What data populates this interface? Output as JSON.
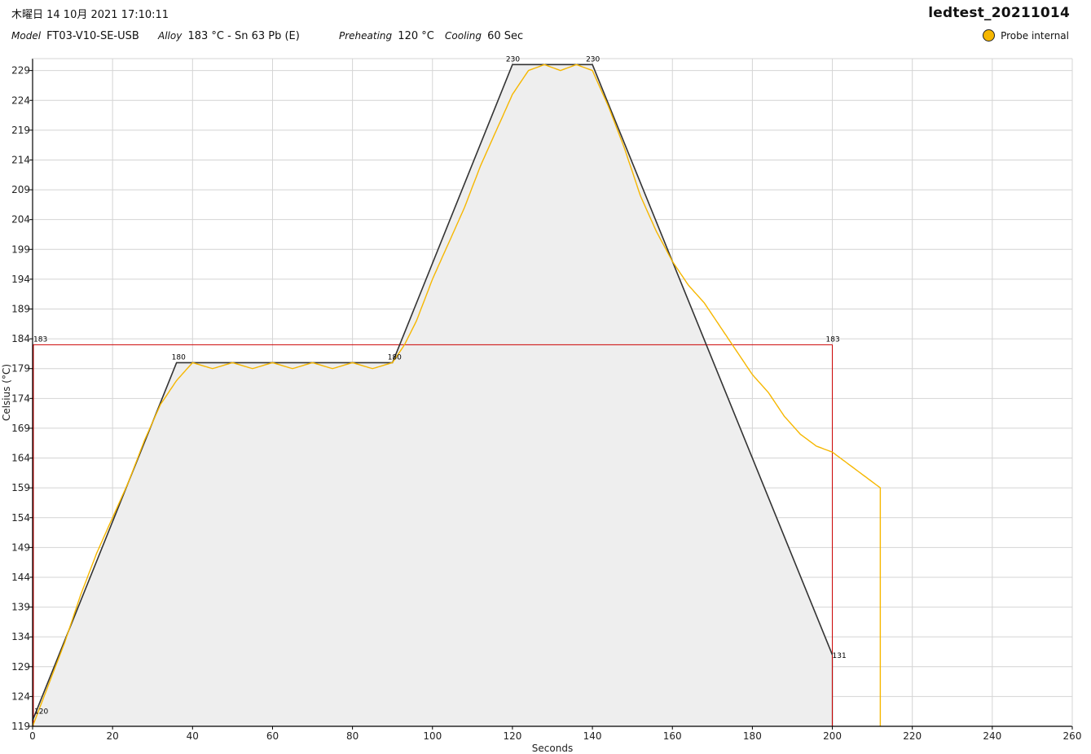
{
  "header": {
    "datetime": "木曜日 14 10月 2021 17:10:11",
    "title": "ledtest_20211014",
    "model_label": "Model",
    "model_value": "FT03-V10-SE-USB",
    "alloy_label": "Alloy",
    "alloy_value": "183 °C - Sn 63 Pb (E)",
    "preheating_label": "Preheating",
    "preheating_value": "120 °C",
    "cooling_label": "Cooling",
    "cooling_value": "60 Sec"
  },
  "legend": {
    "probe_label": "Probe internal",
    "probe_color": "#f6b700"
  },
  "colors": {
    "profile": "#333333",
    "fill": "#eeeeee",
    "alloy_line": "#cc0000",
    "grid": "#d4d4d4"
  },
  "chart_data": {
    "type": "line",
    "xlabel": "Seconds",
    "ylabel": "Celsius (°C)",
    "xlim": [
      0,
      260
    ],
    "ylim": [
      119,
      231
    ],
    "x_ticks": [
      0,
      20,
      40,
      60,
      80,
      100,
      120,
      140,
      160,
      180,
      200,
      220,
      240,
      260
    ],
    "y_ticks": [
      119,
      124,
      129,
      134,
      139,
      144,
      149,
      154,
      159,
      164,
      169,
      174,
      179,
      184,
      189,
      194,
      199,
      204,
      209,
      214,
      219,
      224,
      229
    ],
    "grid": true,
    "legend_position": "top-right",
    "profile": {
      "x": [
        0,
        36,
        90,
        120,
        140,
        200
      ],
      "y": [
        120,
        180,
        180,
        230,
        230,
        131
      ],
      "point_labels": [
        "120",
        "180",
        "180",
        "230",
        "230",
        "131"
      ]
    },
    "alloy_threshold": {
      "y": 183,
      "x_end": 200,
      "labels": [
        "183",
        "183"
      ]
    },
    "series": [
      {
        "name": "Probe internal",
        "x": [
          0,
          4,
          8,
          12,
          16,
          20,
          24,
          28,
          32,
          36,
          40,
          45,
          50,
          55,
          60,
          65,
          70,
          75,
          80,
          85,
          90,
          93,
          96,
          100,
          104,
          108,
          112,
          116,
          120,
          124,
          128,
          132,
          136,
          140,
          144,
          148,
          152,
          156,
          160,
          164,
          168,
          172,
          176,
          180,
          184,
          188,
          192,
          196,
          200,
          204,
          208,
          212,
          212
        ],
        "y": [
          119,
          126,
          133,
          141,
          148,
          154,
          160,
          167,
          173,
          177,
          180,
          179,
          180,
          179,
          180,
          179,
          180,
          179,
          180,
          179,
          180,
          183,
          187,
          194,
          200,
          206,
          213,
          219,
          225,
          229,
          230,
          229,
          230,
          229,
          223,
          216,
          208,
          202,
          197,
          193,
          190,
          186,
          182,
          178,
          175,
          171,
          168,
          166,
          165,
          163,
          161,
          159,
          119
        ]
      }
    ]
  }
}
